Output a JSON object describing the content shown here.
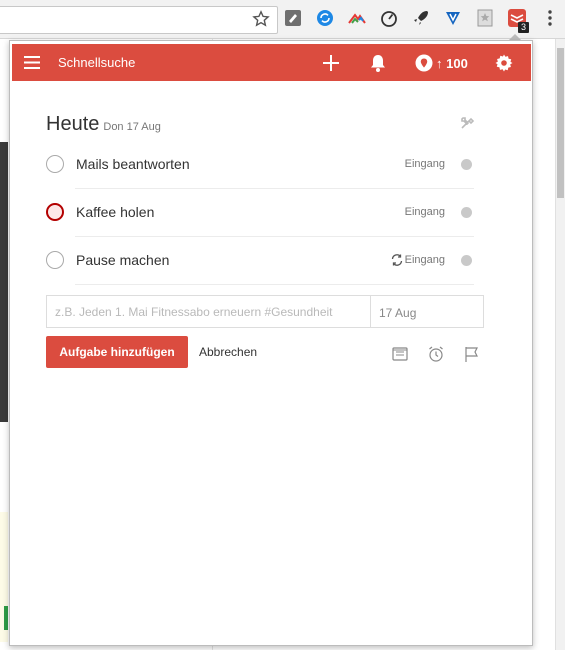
{
  "browser": {
    "extension_badge_count": "3"
  },
  "header": {
    "quicksearch_label": "Schnellsuche",
    "karma_label": "↑ 100",
    "accent_color": "#db4c3f"
  },
  "view": {
    "title": "Heute",
    "date": "Don 17 Aug"
  },
  "tasks": [
    {
      "content": "Mails beantworten",
      "project": "Eingang",
      "priority": "normal",
      "recurring": false
    },
    {
      "content": "Kaffee holen",
      "project": "Eingang",
      "priority": "p1",
      "recurring": false
    },
    {
      "content": "Pause machen",
      "project": "Eingang",
      "priority": "normal",
      "recurring": true
    }
  ],
  "add_task": {
    "placeholder": "z.B. Jeden 1. Mai Fitnessabo erneuern #Gesundheit",
    "due_date": "17 Aug",
    "submit_label": "Aufgabe hinzufügen",
    "cancel_label": "Abbrechen"
  }
}
